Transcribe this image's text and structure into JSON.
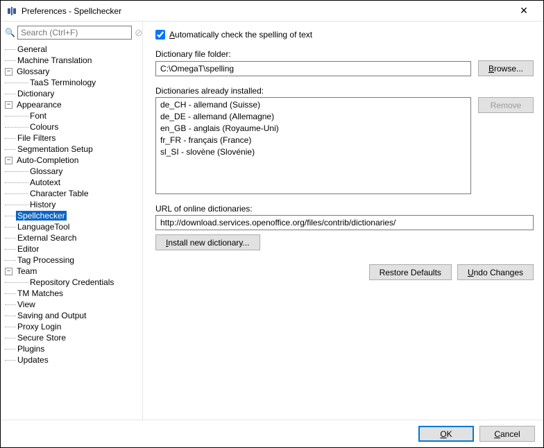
{
  "window": {
    "title": "Preferences - Spellchecker"
  },
  "search": {
    "placeholder": "Search (Ctrl+F)"
  },
  "tree": {
    "general": "General",
    "machine_translation": "Machine Translation",
    "glossary": "Glossary",
    "taas": "TaaS Terminology",
    "dictionary": "Dictionary",
    "appearance": "Appearance",
    "font": "Font",
    "colours": "Colours",
    "file_filters": "File Filters",
    "segmentation_setup": "Segmentation Setup",
    "auto_completion": "Auto-Completion",
    "ac_glossary": "Glossary",
    "ac_autotext": "Autotext",
    "ac_chartable": "Character Table",
    "ac_history": "History",
    "spellchecker": "Spellchecker",
    "languagetool": "LanguageTool",
    "external_search": "External Search",
    "editor": "Editor",
    "tag_processing": "Tag Processing",
    "team": "Team",
    "repo_creds": "Repository Credentials",
    "tm_matches": "TM Matches",
    "view": "View",
    "saving_output": "Saving and Output",
    "proxy_login": "Proxy Login",
    "secure_store": "Secure Store",
    "plugins": "Plugins",
    "updates": "Updates"
  },
  "panel": {
    "auto_check_label": "Automatically check the spelling of text",
    "auto_check_checked": true,
    "dict_folder_label": "Dictionary file folder:",
    "dict_folder_value": "C:\\OmegaT\\spelling",
    "browse_label": "Browse...",
    "installed_label": "Dictionaries already installed:",
    "installed_items": [
      "de_CH - allemand (Suisse)",
      "de_DE - allemand (Allemagne)",
      "en_GB - anglais (Royaume-Uni)",
      "fr_FR - français (France)",
      "sl_SI - slovène (Slovénie)"
    ],
    "remove_label": "Remove",
    "url_label": "URL of online dictionaries:",
    "url_value": "http://download.services.openoffice.org/files/contrib/dictionaries/",
    "install_label": "Install new dictionary...",
    "restore_label": "Restore Defaults",
    "undo_label": "Undo Changes"
  },
  "footer": {
    "ok": "OK",
    "cancel": "Cancel"
  }
}
